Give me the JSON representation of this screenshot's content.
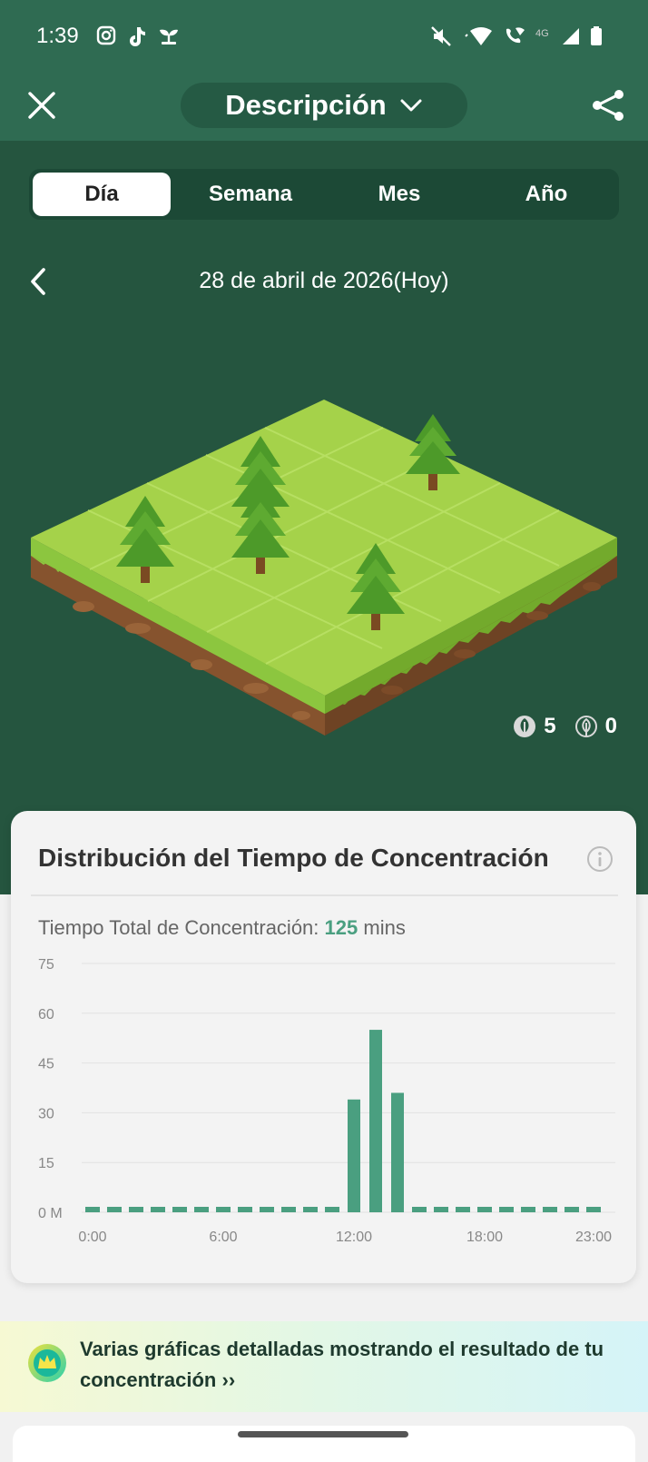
{
  "status_bar": {
    "time": "1:39",
    "icons": [
      "instagram-icon",
      "tiktok-icon",
      "sprout-icon",
      "mute-icon",
      "wifi-icon",
      "wifi-calling-icon",
      "4g-icon",
      "signal-icon",
      "battery-icon"
    ]
  },
  "header": {
    "title": "Descripción"
  },
  "tabs": [
    {
      "label": "Día",
      "active": true
    },
    {
      "label": "Semana",
      "active": false
    },
    {
      "label": "Mes",
      "active": false
    },
    {
      "label": "Año",
      "active": false
    }
  ],
  "date_label": "28 de abril de 2026(Hoy)",
  "forest_counts": {
    "healthy": "5",
    "withered": "0"
  },
  "distribution": {
    "title": "Distribución del Tiempo de Concentración",
    "total_label": "Tiempo Total de Concentración:",
    "total_value": "125",
    "total_unit": "mins"
  },
  "chart_data": {
    "type": "bar",
    "x": [
      0,
      1,
      2,
      3,
      4,
      5,
      6,
      7,
      8,
      9,
      10,
      11,
      12,
      13,
      14,
      15,
      16,
      17,
      18,
      19,
      20,
      21,
      22,
      23
    ],
    "values": [
      0,
      0,
      0,
      0,
      0,
      0,
      0,
      0,
      0,
      0,
      0,
      0,
      34,
      55,
      36,
      0,
      0,
      0,
      0,
      0,
      0,
      0,
      0,
      0
    ],
    "x_tick_labels": [
      "0:00",
      "6:00",
      "12:00",
      "18:00",
      "23:00"
    ],
    "y_tick_labels": [
      "0 M",
      "15",
      "30",
      "45",
      "60",
      "75"
    ],
    "ylim": [
      0,
      75
    ],
    "color": "#4a9f80",
    "grid": true
  },
  "promo": {
    "text": "Varias gráficas detalladas mostrando el resultado de tu concentración",
    "arrow": "››"
  },
  "colors": {
    "status_bg": "#2f6b52",
    "main_bg": "#25553f",
    "accent": "#4a9f80"
  }
}
